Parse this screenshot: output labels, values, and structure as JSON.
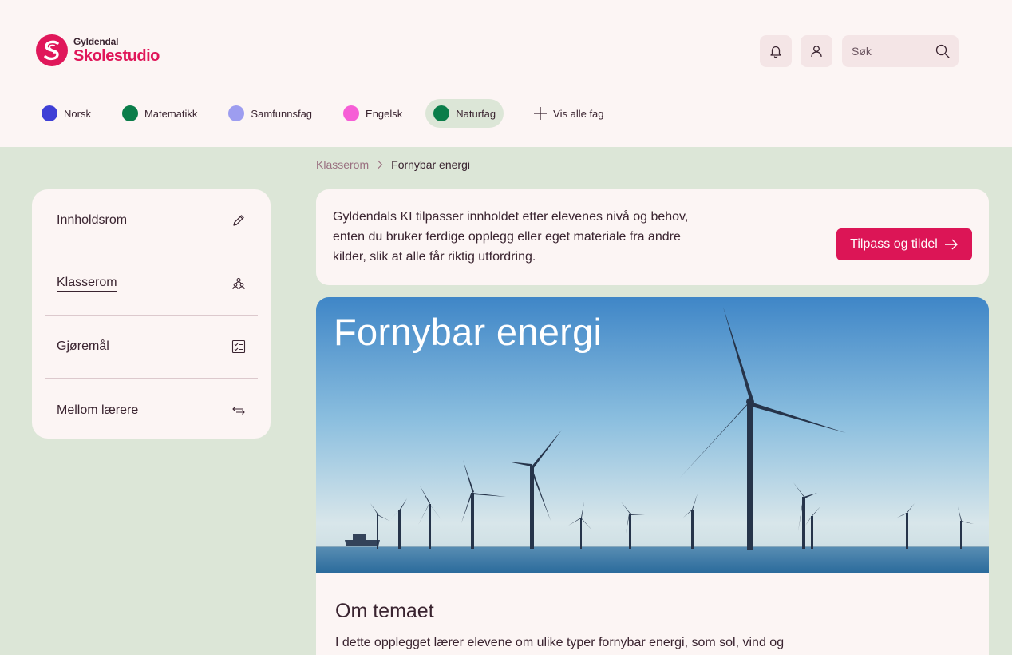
{
  "brand": {
    "publisher": "Gyldendal",
    "product": "Skolestudio",
    "color": "#e0175a"
  },
  "header": {
    "search_placeholder": "Søk"
  },
  "subjects": [
    {
      "label": "Norsk",
      "color": "#3e3fd6",
      "active": false
    },
    {
      "label": "Matematikk",
      "color": "#0b7d4a",
      "active": false
    },
    {
      "label": "Samfunnsfag",
      "color": "#9d9df0",
      "active": false
    },
    {
      "label": "Engelsk",
      "color": "#f65ed6",
      "active": false
    },
    {
      "label": "Naturfag",
      "color": "#0b7d4a",
      "active": true
    }
  ],
  "show_all_label": "Vis alle fag",
  "breadcrumb": {
    "parent": "Klasserom",
    "current": "Fornybar energi"
  },
  "sidebar": {
    "items": [
      {
        "label": "Innholdsrom",
        "icon": "pencil-icon"
      },
      {
        "label": "Klasserom",
        "icon": "people-icon",
        "current": true
      },
      {
        "label": "Gjøremål",
        "icon": "checklist-icon"
      },
      {
        "label": "Mellom lærere",
        "icon": "arrows-exchange-icon"
      }
    ]
  },
  "info": {
    "text": "Gyldendals KI tilpasser innholdet etter elevenes nivå og behov, enten du bruker ferdige opplegg eller eget materiale fra andre kilder, slik at alle får riktig utfordring.",
    "cta_label": "Tilpass og tildel"
  },
  "hero": {
    "title": "Fornybar energi"
  },
  "content": {
    "heading": "Om temaet",
    "body": "I dette opplegget lærer elevene om ulike typer fornybar energi, som sol, vind og"
  }
}
